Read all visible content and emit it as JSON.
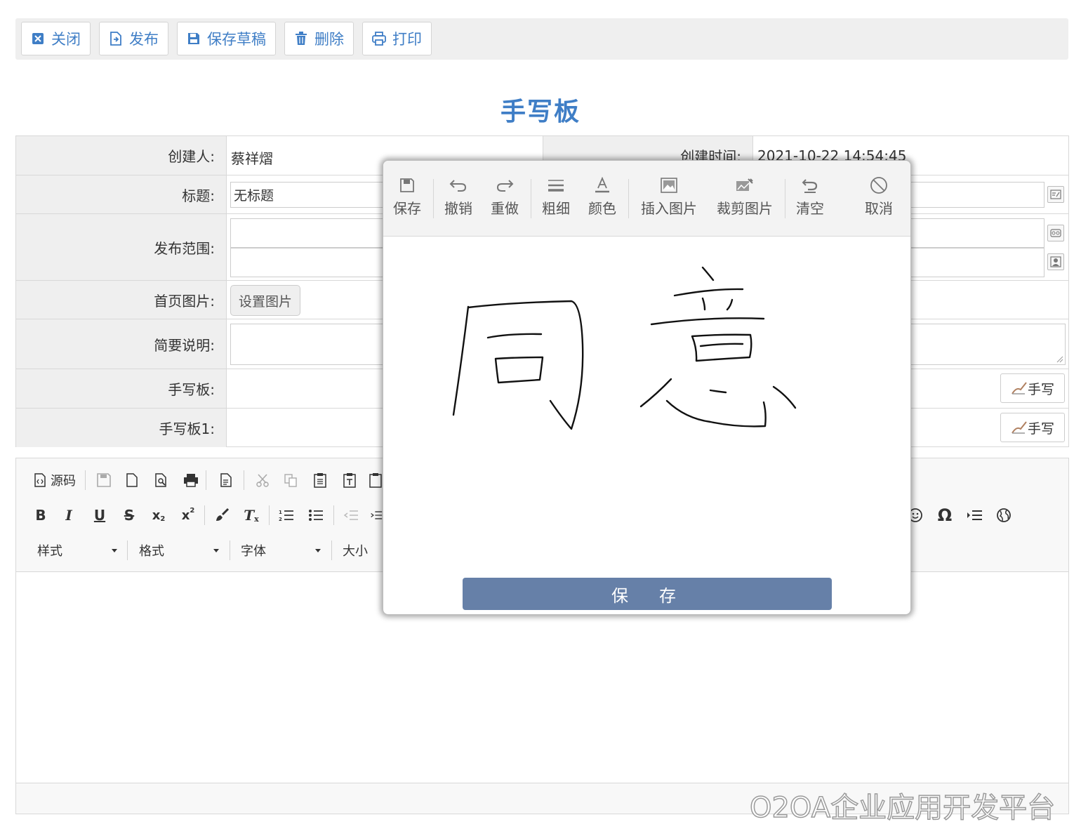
{
  "actionbar": {
    "close": "关闭",
    "publish": "发布",
    "save_draft": "保存草稿",
    "delete": "删除",
    "print": "打印"
  },
  "page_title": "手写板",
  "form": {
    "creator_label": "创建人:",
    "creator_value": "蔡祥熠",
    "created_time_label": "创建时间:",
    "created_time_value": "2021-10-22 14:54:45",
    "title_label": "标题:",
    "title_value": "无标题",
    "scope_label": "发布范围:",
    "home_image_label": "首页图片:",
    "set_image_button": "设置图片",
    "summary_label": "简要说明:",
    "handwrite_label": "手写板:",
    "handwrite1_label": "手写板1:",
    "handwrite_button": "手写"
  },
  "editor": {
    "source_label": "源码",
    "combos": [
      "样式",
      "格式",
      "字体",
      "大小"
    ]
  },
  "dialog": {
    "tools": [
      "保存",
      "撤销",
      "重做",
      "粗细",
      "颜色",
      "插入图片",
      "裁剪图片",
      "清空",
      "取消"
    ],
    "save_button": "保　存"
  },
  "watermark": "O2OA企业应用开发平台",
  "colors": {
    "accent": "#3f7ec6",
    "save_button": "#6680a8",
    "label_bg": "#efefef"
  }
}
